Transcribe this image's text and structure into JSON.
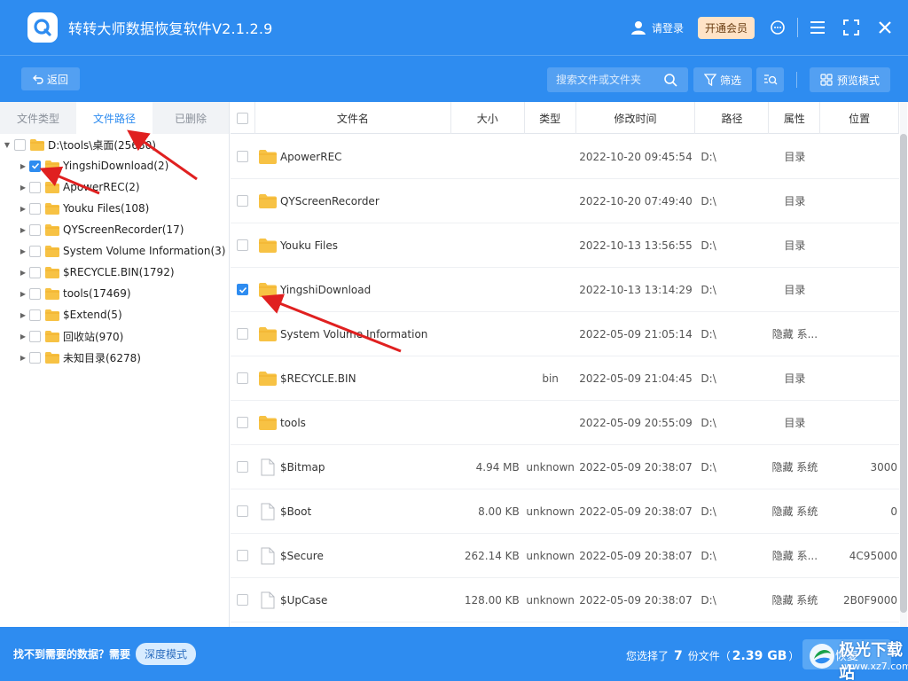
{
  "app": {
    "title": "转转大师数据恢复软件V2.1.2.9"
  },
  "titlebar": {
    "login": "请登录",
    "vip": "开通会员"
  },
  "toolbar": {
    "back": "返回",
    "search_placeholder": "搜索文件或文件夹",
    "filter": "筛选",
    "preview": "预览模式"
  },
  "left_tabs": [
    "文件类型",
    "文件路径",
    "已删除"
  ],
  "active_tab": 1,
  "tree": {
    "root": "D:\\tools\\桌面(25680)",
    "items": [
      {
        "label": "YingshiDownload(2)",
        "checked": true
      },
      {
        "label": "ApowerREC(2)",
        "checked": false
      },
      {
        "label": "Youku Files(108)",
        "checked": false
      },
      {
        "label": "QYScreenRecorder(17)",
        "checked": false
      },
      {
        "label": "System Volume Information(3)",
        "checked": false
      },
      {
        "label": "$RECYCLE.BIN(1792)",
        "checked": false
      },
      {
        "label": "tools(17469)",
        "checked": false
      },
      {
        "label": "$Extend(5)",
        "checked": false
      },
      {
        "label": "回收站(970)",
        "checked": false
      },
      {
        "label": "未知目录(6278)",
        "checked": false
      }
    ]
  },
  "table": {
    "columns": [
      "文件名",
      "大小",
      "类型",
      "修改时间",
      "路径",
      "属性",
      "位置"
    ],
    "rows": [
      {
        "name": "ApowerREC",
        "kind": "folder",
        "size": "",
        "type": "",
        "mtime": "2022-10-20 09:45:54",
        "path": "D:\\",
        "attr": "目录",
        "pos": "",
        "checked": false
      },
      {
        "name": "QYScreenRecorder",
        "kind": "folder",
        "size": "",
        "type": "",
        "mtime": "2022-10-20 07:49:40",
        "path": "D:\\",
        "attr": "目录",
        "pos": "",
        "checked": false
      },
      {
        "name": "Youku Files",
        "kind": "folder",
        "size": "",
        "type": "",
        "mtime": "2022-10-13 13:56:55",
        "path": "D:\\",
        "attr": "目录",
        "pos": "",
        "checked": false
      },
      {
        "name": "YingshiDownload",
        "kind": "folder",
        "size": "",
        "type": "",
        "mtime": "2022-10-13 13:14:29",
        "path": "D:\\",
        "attr": "目录",
        "pos": "",
        "checked": true
      },
      {
        "name": "System Volume Information",
        "kind": "folder",
        "size": "",
        "type": "",
        "mtime": "2022-05-09 21:05:14",
        "path": "D:\\",
        "attr": "隐藏 系...",
        "pos": "",
        "checked": false
      },
      {
        "name": "$RECYCLE.BIN",
        "kind": "folder",
        "size": "",
        "type": "bin",
        "mtime": "2022-05-09 21:04:45",
        "path": "D:\\",
        "attr": "目录",
        "pos": "",
        "checked": false
      },
      {
        "name": "tools",
        "kind": "folder",
        "size": "",
        "type": "",
        "mtime": "2022-05-09 20:55:09",
        "path": "D:\\",
        "attr": "目录",
        "pos": "",
        "checked": false
      },
      {
        "name": "$Bitmap",
        "kind": "file",
        "size": "4.94 MB",
        "type": "unknown",
        "mtime": "2022-05-09 20:38:07",
        "path": "D:\\",
        "attr": "隐藏 系统",
        "pos": "3000",
        "checked": false
      },
      {
        "name": "$Boot",
        "kind": "file",
        "size": "8.00 KB",
        "type": "unknown",
        "mtime": "2022-05-09 20:38:07",
        "path": "D:\\",
        "attr": "隐藏 系统",
        "pos": "0",
        "checked": false
      },
      {
        "name": "$Secure",
        "kind": "file",
        "size": "262.14 KB",
        "type": "unknown",
        "mtime": "2022-05-09 20:38:07",
        "path": "D:\\",
        "attr": "隐藏 系...",
        "pos": "4C95000",
        "checked": false
      },
      {
        "name": "$UpCase",
        "kind": "file",
        "size": "128.00 KB",
        "type": "unknown",
        "mtime": "2022-05-09 20:38:07",
        "path": "D:\\",
        "attr": "隐藏 系统",
        "pos": "2B0F9000",
        "checked": false
      }
    ]
  },
  "footer": {
    "prompt": "找不到需要的数据？需要",
    "deep_mode": "深度模式",
    "selected_prefix": "您选择了",
    "selected_count": "7",
    "selected_unit": "份文件（",
    "selected_size": "2.39 GB",
    "selected_suffix": "）",
    "recover": "恢复"
  },
  "watermark": {
    "title": "极光下载站",
    "url": "www.xz7.com"
  },
  "colors": {
    "brand": "#2e8cf0",
    "folder": "#f7c244",
    "arrow": "#e02020"
  },
  "icons": [
    "logo-icon",
    "user-icon",
    "support-icon",
    "menu-icon",
    "fullscreen-icon",
    "close-icon",
    "back-icon",
    "search-icon",
    "filter-icon",
    "find-icon",
    "grid-icon",
    "folder-icon",
    "file-icon",
    "caret-icon",
    "checkbox-icon"
  ]
}
